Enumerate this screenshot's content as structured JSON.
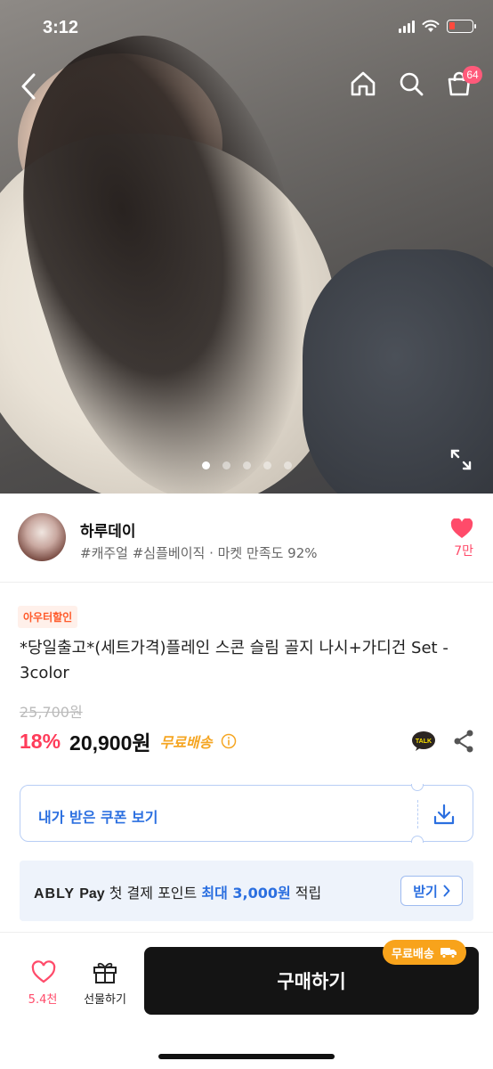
{
  "status_bar": {
    "time": "3:12"
  },
  "header": {
    "cart_count": "64"
  },
  "gallery": {
    "slide_count": 5,
    "active_index": 0
  },
  "shop": {
    "name": "하루데이",
    "tags": "#캐주얼 #심플베이직 · 마켓 만족도 92%",
    "like_count": "7만"
  },
  "product": {
    "promo_tag": "아우터할인",
    "title": "*당일출고*(세트가격)플레인 스콘 슬림 골지 나시+가디건 Set - 3color",
    "original_price": "25,700원",
    "discount_percent": "18%",
    "price": "20,900원",
    "shipping": "무료배송"
  },
  "coupon": {
    "label": "내가 받은 쿠폰 보기"
  },
  "pay_banner": {
    "brand": "ABLY",
    "brand_suffix": "Pay",
    "text_before": "첫 결제 포인트",
    "highlight": "최대 3,000원",
    "text_after": "적립",
    "button_label": "받기"
  },
  "bottom_bar": {
    "like_count": "5.4천",
    "gift_label": "선물하기",
    "buy_label": "구매하기",
    "free_shipping_badge": "무료배송"
  },
  "colors": {
    "accent_pink": "#ff4b6a",
    "accent_blue": "#2b6fe0",
    "accent_orange": "#f8a31b",
    "buy_button": "#141414"
  }
}
